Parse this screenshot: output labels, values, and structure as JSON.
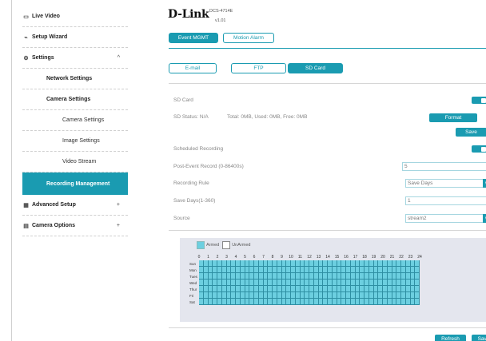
{
  "sidebar": {
    "live_video": "Live Video",
    "setup_wizard": "Setup Wizard",
    "settings": "Settings",
    "settings_caret": "^",
    "network_settings": "Network Settings",
    "camera_settings": "Camera Settings",
    "camera_settings_sub": "Camera Settings",
    "image_settings": "Image Settings",
    "video_stream": "Video Stream",
    "recording_management": "Recording Management",
    "advanced_setup": "Advanced Setup",
    "advanced_caret": "+",
    "camera_options": "Camera Options",
    "camera_options_caret": "+"
  },
  "header": {
    "logo": "D-Link",
    "model": "DCS-4714E",
    "firmware": "v1.01"
  },
  "tabs": {
    "event_mgmt": "Event MGMT",
    "motion_alarm": "Motion Alarm"
  },
  "subtabs": {
    "email": "E-mail",
    "ftp": "FTP",
    "sd_card": "SD Card"
  },
  "sd": {
    "sd_card_label": "SD Card",
    "status": "SD Status: N/A",
    "sizes": "Total: 0MB, Used: 0MB, Free: 0MB",
    "format_button": "Format",
    "save_button": "Save",
    "scheduled_recording": "Scheduled Recording",
    "post_event_label": "Post-Event Record (0-86400s)",
    "post_event_value": "5",
    "recording_rule_label": "Recording Rule",
    "recording_rule_value": "Save Days",
    "save_days_label": "Save Days(1-360)",
    "save_days_value": "1",
    "source_label": "Source",
    "source_value": "stream2"
  },
  "schedule": {
    "armed": "Armed",
    "unarmed": "UnArmed",
    "hours": [
      "0",
      "1",
      "2",
      "3",
      "4",
      "5",
      "6",
      "7",
      "8",
      "9",
      "10",
      "11",
      "12",
      "13",
      "14",
      "15",
      "16",
      "17",
      "18",
      "19",
      "20",
      "21",
      "22",
      "23",
      "24"
    ],
    "days": [
      "Sun",
      "Mon",
      "Tues",
      "Wed",
      "Thur",
      "Fri",
      "Sat"
    ],
    "armed_color": "#6ccfe0"
  },
  "footer": {
    "refresh": "Refresh",
    "save": "Save"
  },
  "colors": {
    "accent": "#1a9bb1"
  }
}
